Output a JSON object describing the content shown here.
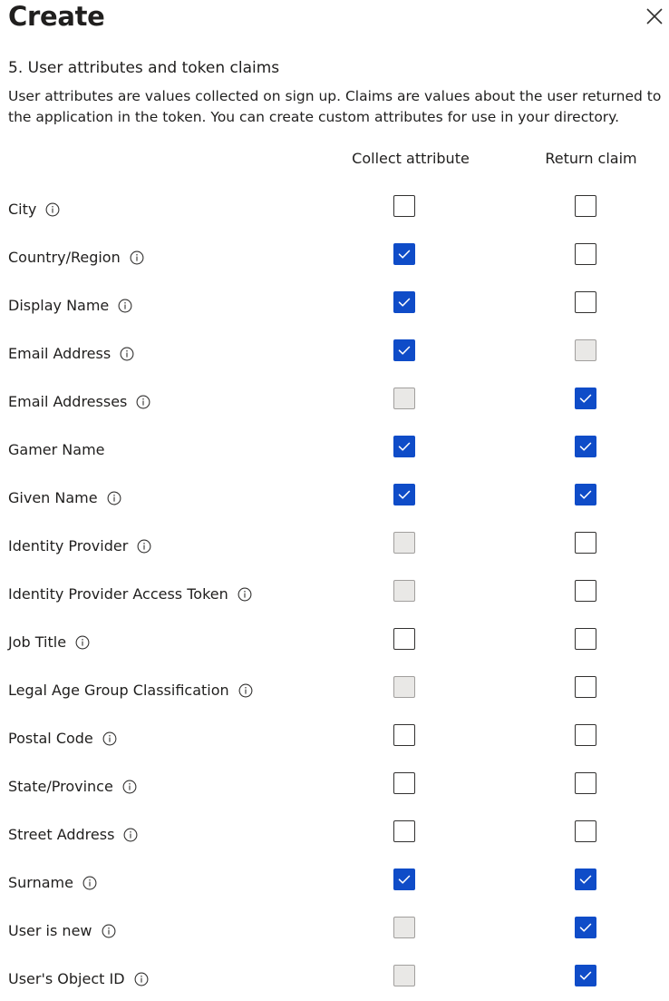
{
  "header": {
    "title": "Create",
    "close_icon": "close-icon"
  },
  "section": {
    "title": "5. User attributes and token claims",
    "description": "User attributes are values collected on sign up. Claims are values about the user returned to the application in the token. You can create custom attributes for use in your directory."
  },
  "columns": {
    "collect": "Collect attribute",
    "claim": "Return claim"
  },
  "colors": {
    "checked": "#0f4cc8",
    "disabled": "#e9e8e6"
  },
  "attributes": [
    {
      "name": "City",
      "info": true,
      "collect": "unchecked",
      "claim": "unchecked"
    },
    {
      "name": "Country/Region",
      "info": true,
      "collect": "checked",
      "claim": "unchecked"
    },
    {
      "name": "Display Name",
      "info": true,
      "collect": "checked",
      "claim": "unchecked"
    },
    {
      "name": "Email Address",
      "info": true,
      "collect": "checked",
      "claim": "disabled"
    },
    {
      "name": "Email Addresses",
      "info": true,
      "collect": "disabled",
      "claim": "checked"
    },
    {
      "name": "Gamer Name",
      "info": false,
      "collect": "checked",
      "claim": "checked"
    },
    {
      "name": "Given Name",
      "info": true,
      "collect": "checked",
      "claim": "checked"
    },
    {
      "name": "Identity Provider",
      "info": true,
      "collect": "disabled",
      "claim": "unchecked"
    },
    {
      "name": "Identity Provider Access Token",
      "info": true,
      "collect": "disabled",
      "claim": "unchecked"
    },
    {
      "name": "Job Title",
      "info": true,
      "collect": "unchecked",
      "claim": "unchecked"
    },
    {
      "name": "Legal Age Group Classification",
      "info": true,
      "collect": "disabled",
      "claim": "unchecked"
    },
    {
      "name": "Postal Code",
      "info": true,
      "collect": "unchecked",
      "claim": "unchecked"
    },
    {
      "name": "State/Province",
      "info": true,
      "collect": "unchecked",
      "claim": "unchecked"
    },
    {
      "name": "Street Address",
      "info": true,
      "collect": "unchecked",
      "claim": "unchecked"
    },
    {
      "name": "Surname",
      "info": true,
      "collect": "checked",
      "claim": "checked"
    },
    {
      "name": "User is new",
      "info": true,
      "collect": "disabled",
      "claim": "checked"
    },
    {
      "name": "User's Object ID",
      "info": true,
      "collect": "disabled",
      "claim": "checked"
    }
  ]
}
